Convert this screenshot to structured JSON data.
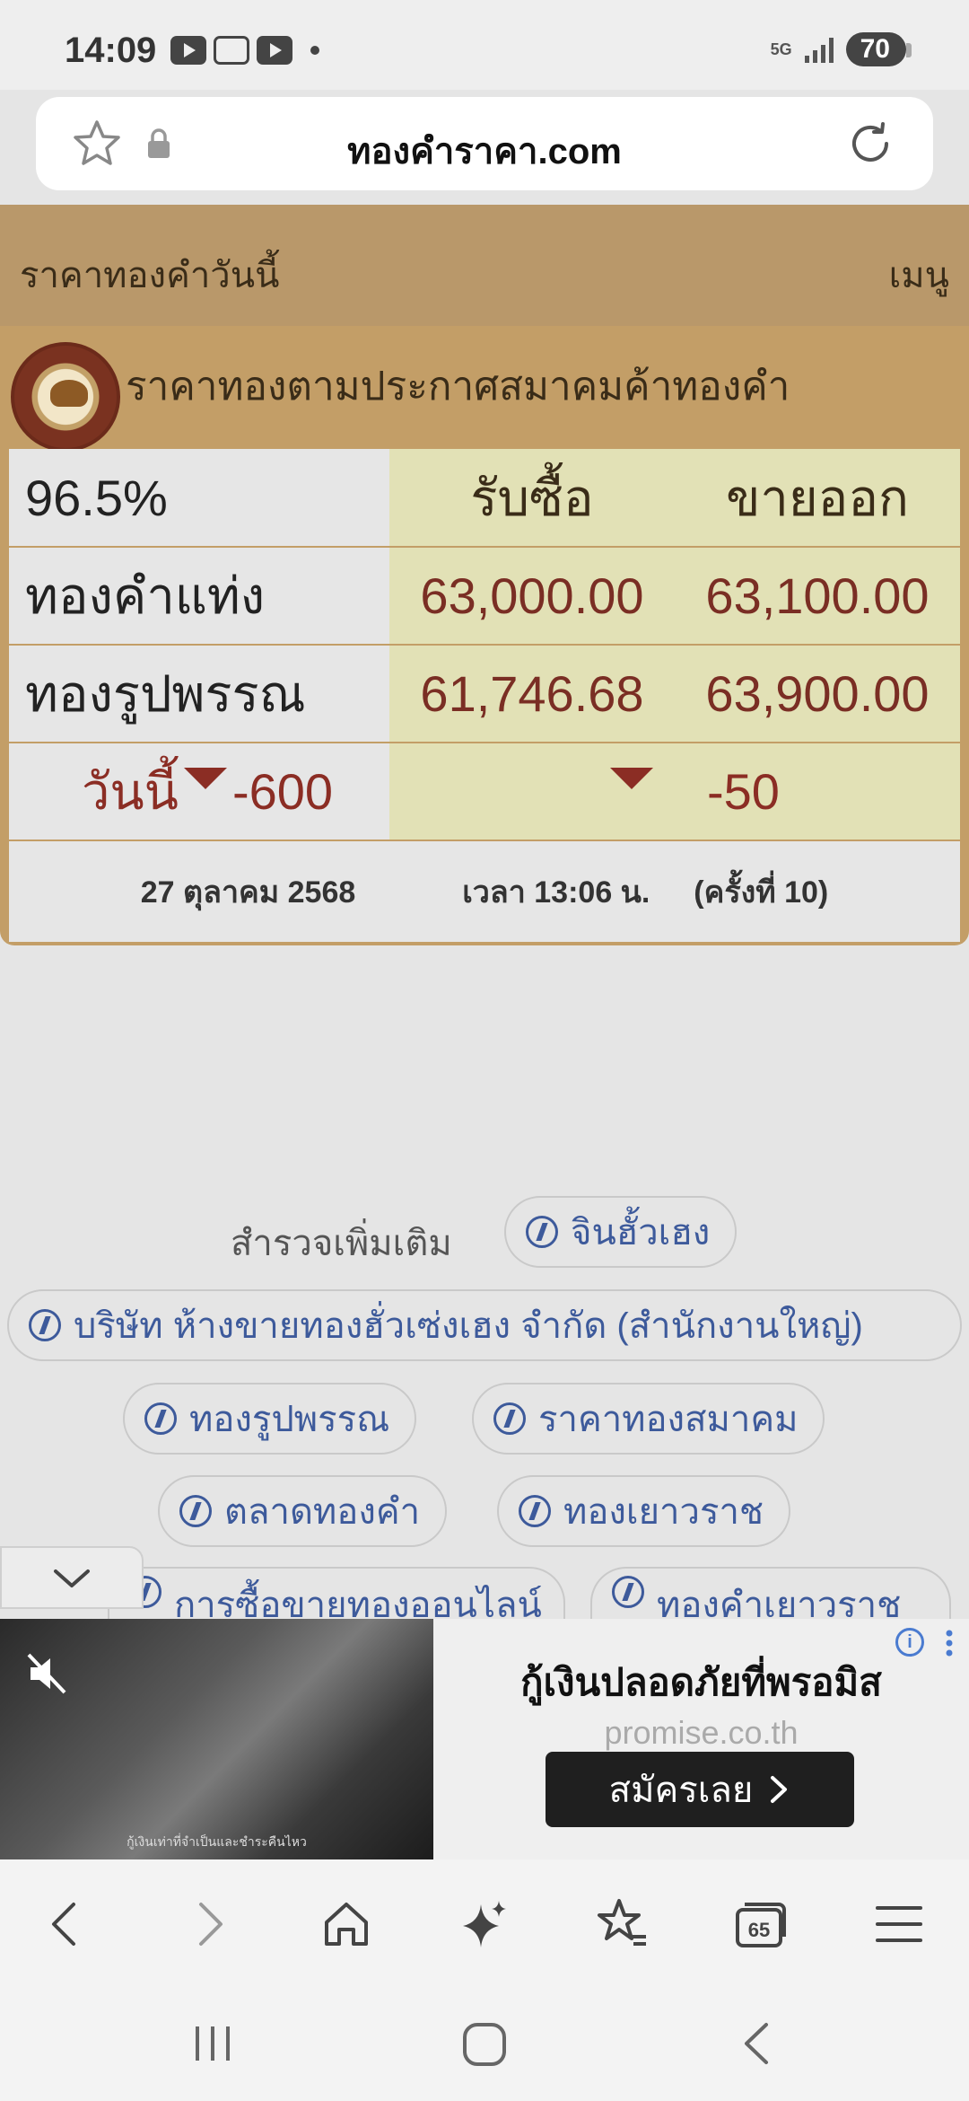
{
  "status_bar": {
    "time": "14:09",
    "network": "5G",
    "battery": "70"
  },
  "url_bar": {
    "url": "ทองคำราคา.com"
  },
  "site_header": {
    "title": "ราคาทองคำวันนี้",
    "menu": "เมนู"
  },
  "gold_panel": {
    "title": "ราคาทองตามประกาศสมาคมค้าทองคำ",
    "purity": "96.5%",
    "col_buy": "รับซื้อ",
    "col_sell": "ขายออก",
    "rows": [
      {
        "label": "ทองคำแท่ง",
        "buy": "63,000.00",
        "sell": "63,100.00"
      },
      {
        "label": "ทองรูปพรรณ",
        "buy": "61,746.68",
        "sell": "63,900.00"
      }
    ],
    "change": {
      "label": "วันนี้",
      "today": "-600",
      "last": "-50",
      "direction": "down"
    },
    "date": "27 ตุลาคม 2568",
    "time": "เวลา 13:06 น.",
    "round": "(ครั้งที่ 10)"
  },
  "explore": {
    "label": "สำรวจเพิ่มเติม",
    "chips": [
      "จินฮั้วเฮง",
      "บริษัท ห้างขายทองฮั่วเซ่งเฮง จำกัด (สำนักงานใหญ่)",
      "ทองรูปพรรณ",
      "ราคาทองสมาคม",
      "ตลาดทองคำ",
      "ทองเยาวราช",
      "การซื้อขายทองออนไลน์",
      "ทองคำเยาวราช"
    ]
  },
  "ad": {
    "title": "กู้เงินปลอดภัยที่พรอมิส",
    "domain": "promise.co.th",
    "cta": "สมัครเลย",
    "image_caption": "กู้เงินเท่าที่จำเป็นและชำระคืนไหว",
    "info_icon": "info-icon"
  },
  "toolbar": {
    "tabs_count": "65"
  },
  "colors": {
    "header_gold": "#b9986a",
    "panel_gold": "#c39e67",
    "price_red": "#7a2e24",
    "chip_blue": "#3d5a9b"
  }
}
